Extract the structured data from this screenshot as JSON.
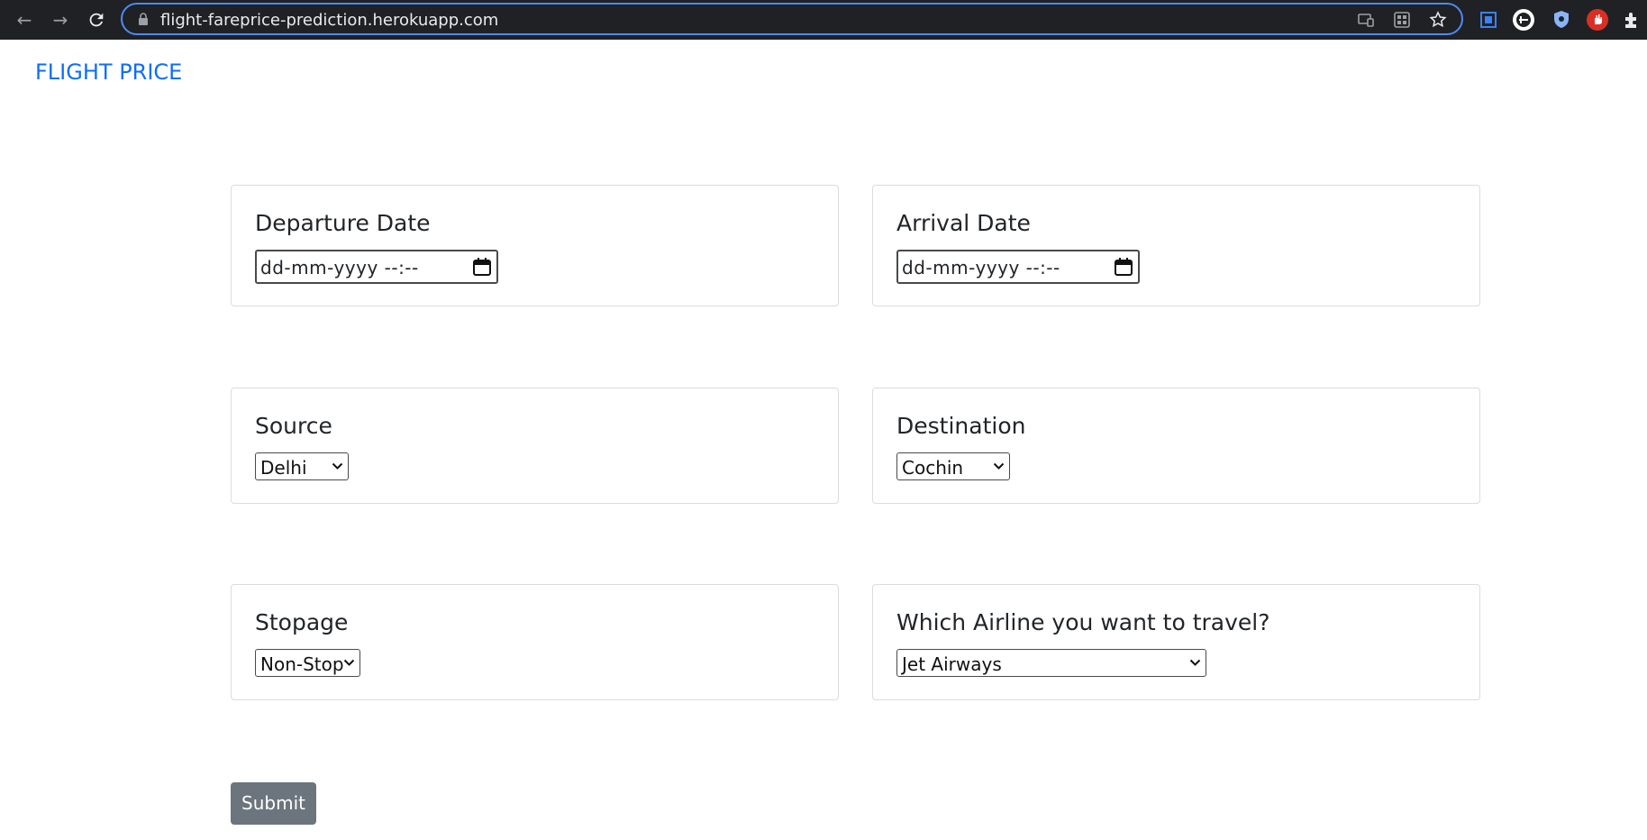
{
  "browser": {
    "url": "flight-fareprice-prediction.herokuapp.com",
    "accent_color": "#4c8bf5"
  },
  "navbar": {
    "brand": "FLIGHT PRICE",
    "brand_color": "#0d6efd"
  },
  "form": {
    "departure": {
      "label": "Departure Date",
      "placeholder": "dd-mm-yyyy --:--"
    },
    "arrival": {
      "label": "Arrival Date",
      "placeholder": "dd-mm-yyyy --:--"
    },
    "source": {
      "label": "Source",
      "selected": "Delhi"
    },
    "destination": {
      "label": "Destination",
      "selected": "Cochin"
    },
    "stopage": {
      "label": "Stopage",
      "selected": "Non-Stop"
    },
    "airline": {
      "label": "Which Airline you want to travel?",
      "selected": "Jet Airways"
    },
    "submit_label": "Submit",
    "submit_color": "#6c757d"
  }
}
